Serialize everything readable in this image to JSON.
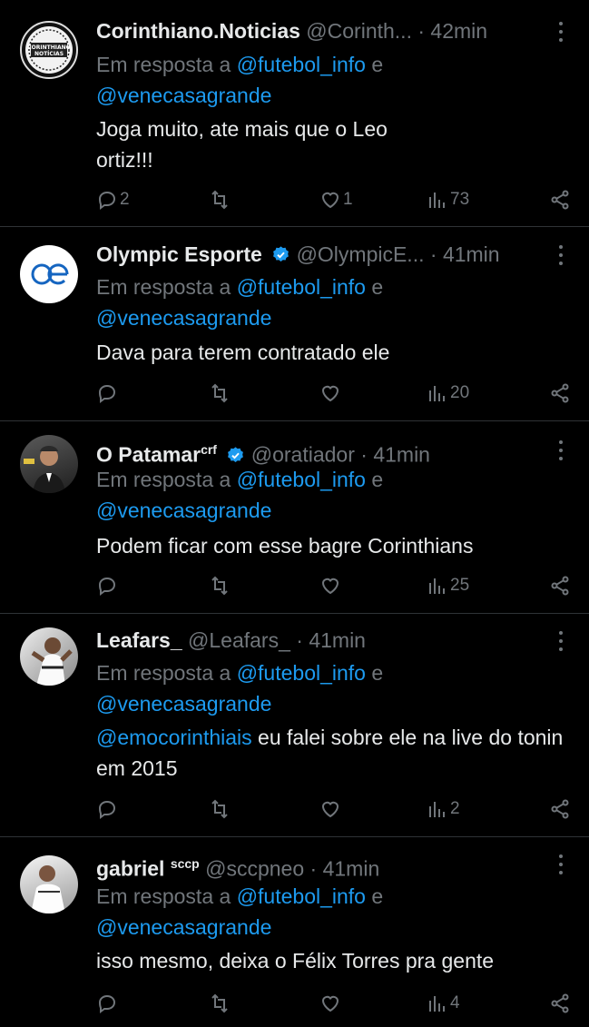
{
  "reply_prefix": "Em resposta a",
  "conjunction": "e",
  "tweets": [
    {
      "name": "Corinthiano.Noticias",
      "handle": "@Corinth...",
      "dot": "·",
      "time": "42min",
      "mention1": "@futebol_info",
      "mention2": "@venecasagrande",
      "body": "Joga muito, ate mais que o Leo ortiz!!!",
      "replies": "2",
      "retweets": "",
      "likes": "1",
      "views": "73"
    },
    {
      "name": "Olympic Esporte",
      "handle": "@OlympicE...",
      "dot": "·",
      "time": "41min",
      "mention1": "@futebol_info",
      "mention2": "@venecasagrande",
      "body": "Dava para terem contratado ele",
      "replies": "",
      "retweets": "",
      "likes": "",
      "views": "20"
    },
    {
      "name": "O Patamar",
      "name_sup": "crf",
      "handle": "@oratiador",
      "dot": "·",
      "time": "41min",
      "mention1": "@futebol_info",
      "mention2": "@venecasagrande",
      "body": "Podem ficar com esse bagre Corinthians",
      "replies": "",
      "retweets": "",
      "likes": "",
      "views": "25"
    },
    {
      "name": "Leafars_",
      "handle": "@Leafars_",
      "dot": "·",
      "time": "41min",
      "mention1": "@futebol_info",
      "mention2": "@venecasagrande",
      "body_mention": "@emocorinthiais",
      "body": "eu falei sobre ele na live do tonin em 2015",
      "replies": "",
      "retweets": "",
      "likes": "",
      "views": "2"
    },
    {
      "name": "gabriel",
      "name_sup": "sccp",
      "handle": "@sccpneo",
      "dot": "·",
      "time": "41min",
      "mention1": "@futebol_info",
      "mention2": "@venecasagrande",
      "body": "isso mesmo, deixa o Félix Torres pra gente",
      "replies": "",
      "retweets": "",
      "likes": "",
      "views": "4"
    }
  ],
  "colors": {
    "background": "#000000",
    "text": "#e7e9ea",
    "muted": "#71767b",
    "link": "#1d9bf0",
    "verified": "#1d9bf0",
    "divider": "#2f3336"
  },
  "avatar_labels": {
    "t0_line1": "CORINTHIANO",
    "t0_line2": "NOTÍCIAS"
  }
}
